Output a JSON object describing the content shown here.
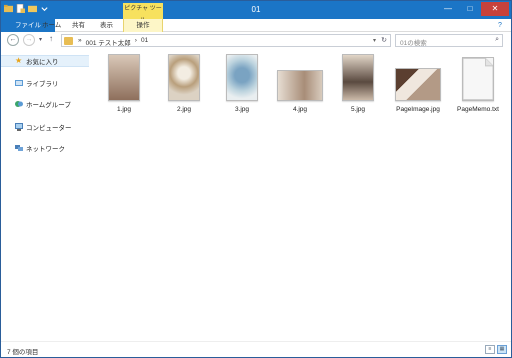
{
  "window": {
    "title": "01",
    "context_tab": "ピクチャ ツール"
  },
  "ribbon": {
    "tabs": [
      {
        "label": "ファイル"
      },
      {
        "label": "ホーム"
      },
      {
        "label": "共有"
      },
      {
        "label": "表示"
      },
      {
        "label": "操作"
      }
    ]
  },
  "address": {
    "crumbs": [
      "»",
      "001 テスト太郎",
      "›",
      "01"
    ]
  },
  "search": {
    "placeholder": "01の検索"
  },
  "sidebar": {
    "items": [
      {
        "label": "お気に入り",
        "icon": "star-icon",
        "color": "#e8a317"
      },
      {
        "label": "ライブラリ",
        "icon": "library-icon",
        "color": "#5b9bd5"
      },
      {
        "label": "ホームグループ",
        "icon": "homegroup-icon",
        "color": "#3aa56a"
      },
      {
        "label": "コンピューター",
        "icon": "computer-icon",
        "color": "#4a7fb8"
      },
      {
        "label": "ネットワーク",
        "icon": "network-icon",
        "color": "#4a7fb8"
      }
    ]
  },
  "files": [
    {
      "name": "1.jpg",
      "thumb": "photo-portrait-baby",
      "color": "#b89a86"
    },
    {
      "name": "2.jpg",
      "thumb": "photo-wreath",
      "color": "#c9b79a"
    },
    {
      "name": "3.jpg",
      "thumb": "photo-blue-flowers",
      "color": "#9fb9c8"
    },
    {
      "name": "4.jpg",
      "thumb": "photo-family",
      "color": "#b7a595"
    },
    {
      "name": "5.jpg",
      "thumb": "photo-mother-child",
      "color": "#9a8a80"
    },
    {
      "name": "PageImage.jpg",
      "thumb": "photo-collage",
      "color": "#c2ab98"
    },
    {
      "name": "PageMemo.txt",
      "thumb": "text-file-icon",
      "color": "#f2f2f2"
    }
  ],
  "status": {
    "count_label": "7 個の項目"
  },
  "colors": {
    "accent": "#1b75c6",
    "context_tab": "#f7e15e",
    "close": "#c7423b"
  }
}
